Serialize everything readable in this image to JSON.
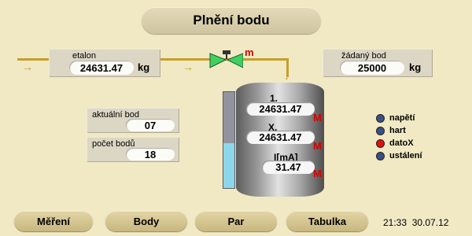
{
  "header": {
    "title": "Plnění bodu"
  },
  "etalon": {
    "label": "etalon",
    "value": "24631.47",
    "unit": "kg"
  },
  "target": {
    "label": "žádaný bod",
    "value": "25000",
    "unit": "kg"
  },
  "current_point": {
    "label": "aktuální bod",
    "value": "07"
  },
  "point_count": {
    "label": "počet bodů",
    "value": "18"
  },
  "valve": {
    "mode_mark": "m"
  },
  "tank": {
    "fill_fraction": 0.47,
    "readings": [
      {
        "label": "1.",
        "value": "24631.47",
        "flag": "M"
      },
      {
        "label": "X.",
        "value": "24631.47",
        "flag": "M"
      },
      {
        "label": "I[mA]",
        "value": "31.47",
        "flag": "M"
      }
    ]
  },
  "legend": [
    {
      "label": "napětí",
      "color": "#3c4f86"
    },
    {
      "label": "hart",
      "color": "#3c4f86"
    },
    {
      "label": "datoX",
      "color": "#e01010"
    },
    {
      "label": "ustálení",
      "color": "#3c4f86"
    }
  ],
  "colors": {
    "pipe": "#c59f2c",
    "valve": "#3fd060",
    "gauge_fill": "#8ed7ea",
    "flag": "#d40000"
  },
  "nav": {
    "buttons": [
      {
        "label": "Měření"
      },
      {
        "label": "Body"
      },
      {
        "label": "Par"
      },
      {
        "label": "Tabulka"
      }
    ]
  },
  "status": {
    "time": "21:33",
    "date": "30.07.12"
  }
}
